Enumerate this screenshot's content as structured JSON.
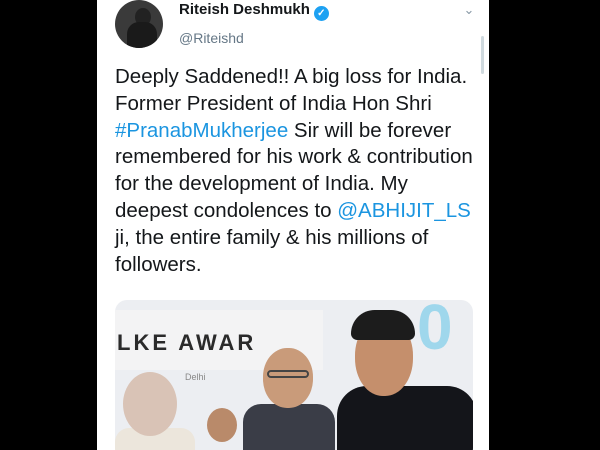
{
  "tweet": {
    "author_name": "Riteish Deshmukh",
    "verified_mark": "✓",
    "handle": "@Riteishd",
    "menu_chevron": "⌄",
    "text_parts": {
      "p1": "Deeply Saddened!! A big loss for India. Former President of India Hon Shri ",
      "hashtag": "#PranabMukherjee",
      "p2": " Sir will be forever remembered for his work & contribution for the development of India. My deepest condolences to ",
      "mention": "@ABHIJIT_LS",
      "p3": " ji, the entire family & his millions of followers."
    }
  },
  "media": {
    "sign_text": "LKE AWAR",
    "sub_text": "Delhi",
    "big_number": "0"
  },
  "colors": {
    "link": "#1b95e0",
    "verified": "#1da1f2",
    "text": "#14171a",
    "muted": "#657786"
  }
}
